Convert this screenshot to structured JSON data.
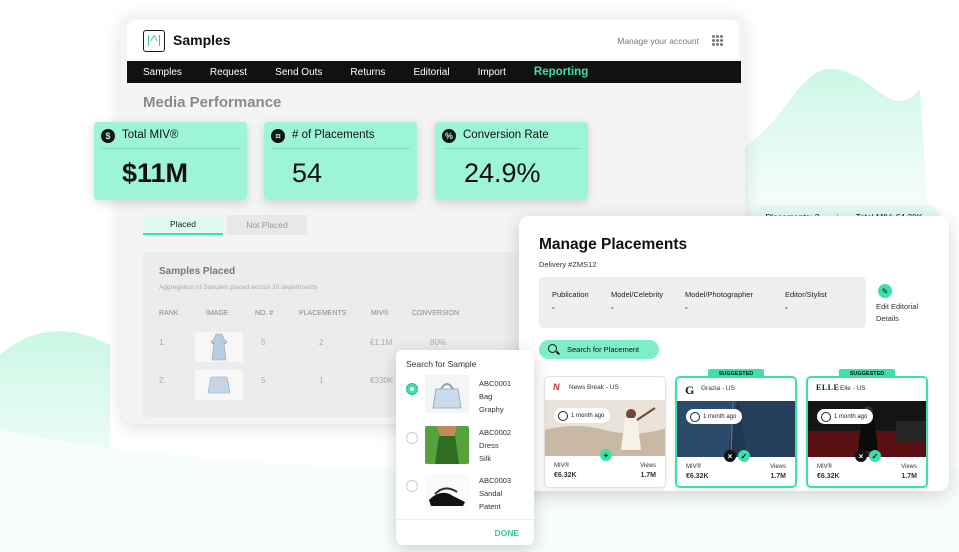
{
  "app": {
    "title": "Samples",
    "manage_account": "Manage your account"
  },
  "nav": [
    "Samples",
    "Request",
    "Send Outs",
    "Returns",
    "Editorial",
    "Import",
    "Reporting"
  ],
  "nav_active": "Reporting",
  "page_title": "Media Performance",
  "kpis": [
    {
      "icon": "$",
      "label": "Total MIV®",
      "value": "$11M"
    },
    {
      "icon": "⌗",
      "label": "# of Placements",
      "value": "54"
    },
    {
      "icon": "%",
      "label": "Conversion Rate",
      "value": "24.9%"
    }
  ],
  "tabs": {
    "placed": "Placed",
    "not_placed": "Not Placed"
  },
  "samples_placed": {
    "title": "Samples Placed",
    "subtitle": "Aggregation of Samples placed across 10 departments",
    "columns": [
      "RANK",
      "IMAGE",
      "NO. #",
      "PLACEMENTS",
      "MIV®",
      "CONVERSION"
    ],
    "rows": [
      {
        "rank": "1.",
        "no": "5",
        "placements": "2",
        "miv": "€1.1M",
        "conversion": "80%"
      },
      {
        "rank": "2.",
        "no": "5",
        "placements": "1",
        "miv": "€330K",
        "conversion": ""
      }
    ]
  },
  "search_sample": {
    "title": "Search for Sample",
    "items": [
      {
        "code": "ABC0001",
        "line2": "Bag",
        "line3": "Graphy",
        "selected": true
      },
      {
        "code": "ABC0002",
        "line2": "Dress",
        "line3": "Silk",
        "selected": false
      },
      {
        "code": "ABC0003",
        "line2": "Sandal",
        "line3": "Patent",
        "selected": false
      }
    ],
    "done": "DONE"
  },
  "summary_pill": {
    "placements": "Placements: 2",
    "sep": "|",
    "miv": "Total MIV: €4.30K"
  },
  "manage": {
    "title": "Manage Placements",
    "delivery": "Delivery #ZMS12",
    "fields": [
      {
        "label": "Publication",
        "value": "-"
      },
      {
        "label": "Model/Celebrity",
        "value": "-"
      },
      {
        "label": "Model/Photographer",
        "value": "-"
      },
      {
        "label": "Editor/Stylist",
        "value": "-"
      }
    ],
    "edit_label": "Edit Editorial Details",
    "search_button": "Search for Placement"
  },
  "placements": [
    {
      "publication": "News Break - US",
      "logo": "N",
      "suggested": false,
      "suggested_label": "",
      "ago": "1 month ago",
      "miv_label": "MIV®",
      "miv": "€6.32K",
      "views_label": "Views",
      "views": "1.7M"
    },
    {
      "publication": "Grazia - US",
      "logo": "G",
      "suggested": true,
      "suggested_label": "SUGGESTED",
      "ago": "1 month ago",
      "miv_label": "MIV®",
      "miv": "€6.32K",
      "views_label": "Views",
      "views": "1.7M"
    },
    {
      "publication": "Elle - US",
      "logo": "ELLE",
      "suggested": true,
      "suggested_label": "SUGGESTED",
      "ago": "1 month ago",
      "miv_label": "MIV®",
      "miv": "€6.32K",
      "views_label": "Views",
      "views": "1.7M"
    }
  ],
  "colors": {
    "accent": "#3ee0a9",
    "kpi_bg": "#9ef5d5",
    "nav_bg": "#111111"
  }
}
